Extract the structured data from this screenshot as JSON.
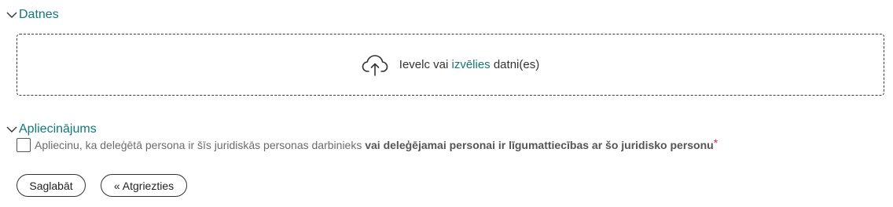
{
  "sections": {
    "files": {
      "title": "Datnes",
      "dropzone": {
        "text_before": "Ievelc vai ",
        "link": "izvēlies",
        "text_after": " datni(es)",
        "icon": "cloud-upload-icon"
      }
    },
    "confirmation": {
      "title": "Apliecinājums",
      "checkbox_checked": false,
      "label_normal": "Apliecinu, ka deleģētā persona ir šīs juridiskās personas darbinieks ",
      "label_bold": "vai deleģējamai personai ir līgumattiecības ar šo juridisko personu",
      "required_marker": "*"
    }
  },
  "actions": {
    "save_label": "Saglabāt",
    "back_label": "« Atgriezties"
  },
  "colors": {
    "accent": "#13777b",
    "required": "#d0343b",
    "text": "#333333",
    "muted_text": "#6b6b6b"
  }
}
